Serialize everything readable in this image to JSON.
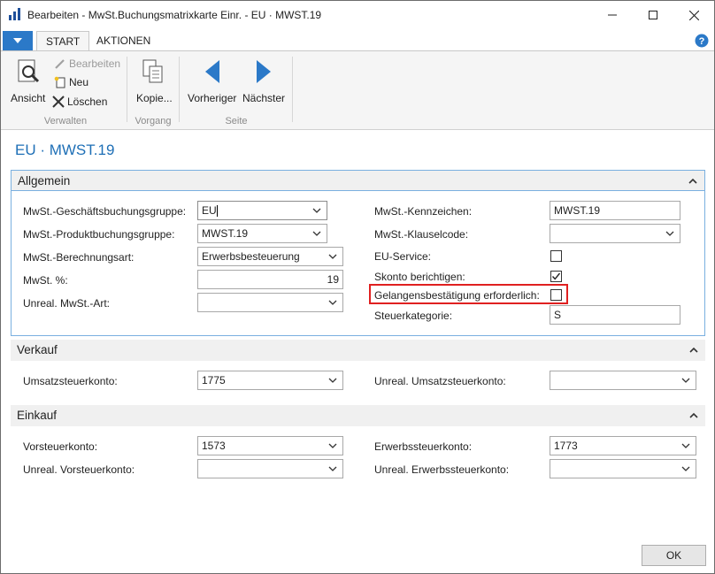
{
  "window": {
    "title": "Bearbeiten - MwSt.Buchungsmatrixkarte Einr. - EU · MWST.19"
  },
  "ribbon": {
    "tabs": [
      "START",
      "AKTIONEN"
    ],
    "groups": {
      "verwalten": {
        "label": "Verwalten",
        "ansicht": "Ansicht",
        "bearbeiten": "Bearbeiten",
        "neu": "Neu",
        "loeschen": "Löschen"
      },
      "vorgang": {
        "label": "Vorgang",
        "kopieren": "Kopie..."
      },
      "seite": {
        "label": "Seite",
        "vorheriger": "Vorheriger",
        "naechster": "Nächster"
      }
    }
  },
  "page": {
    "title": "EU · MWST.19"
  },
  "allgemein": {
    "header": "Allgemein",
    "left": [
      {
        "label": "MwSt.-Geschäftsbuchungsgruppe:",
        "value": "EU"
      },
      {
        "label": "MwSt.-Produktbuchungsgruppe:",
        "value": "MWST.19"
      },
      {
        "label": "MwSt.-Berechnungsart:",
        "value": "Erwerbsbesteuerung"
      },
      {
        "label": "MwSt. %:",
        "value": "19"
      },
      {
        "label": "Unreal. MwSt.-Art:",
        "value": ""
      }
    ],
    "right": {
      "kennzeichen": {
        "label": "MwSt.-Kennzeichen:",
        "value": "MWST.19"
      },
      "klauselcode": {
        "label": "MwSt.-Klauselcode:",
        "value": ""
      },
      "euservice": {
        "label": "EU-Service:",
        "checked": false
      },
      "skonto": {
        "label": "Skonto berichtigen:",
        "checked": true
      },
      "gelangen": {
        "label": "Gelangensbestätigung erforderlich:",
        "checked": false
      },
      "steuerkategorie": {
        "label": "Steuerkategorie:",
        "value": "S"
      }
    }
  },
  "verkauf": {
    "header": "Verkauf",
    "umsatz": {
      "label": "Umsatzsteuerkonto:",
      "value": "1775"
    },
    "unreal_umsatz": {
      "label": "Unreal. Umsatzsteuerkonto:",
      "value": ""
    }
  },
  "einkauf": {
    "header": "Einkauf",
    "vorsteuer": {
      "label": "Vorsteuerkonto:",
      "value": "1573"
    },
    "unreal_vorsteuer": {
      "label": "Unreal. Vorsteuerkonto:",
      "value": ""
    },
    "erwerb": {
      "label": "Erwerbssteuerkonto:",
      "value": "1773"
    },
    "unreal_erwerb": {
      "label": "Unreal. Erwerbssteuerkonto:",
      "value": ""
    }
  },
  "footer": {
    "ok_label": "OK"
  },
  "colors": {
    "accent": "#1e6fb6",
    "highlight": "#e02020",
    "file_button": "#2b79c8"
  }
}
